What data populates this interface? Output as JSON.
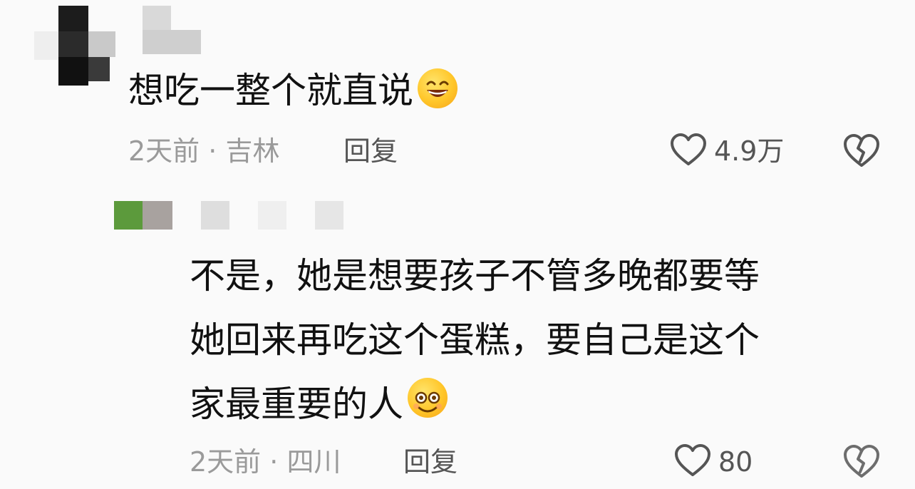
{
  "comment1": {
    "text": "想吃一整个就直说",
    "emoji": "grinning-face-emoji",
    "time": "2天前",
    "location": "吉林",
    "reply_label": "回复",
    "likes": "4.9万"
  },
  "comment2": {
    "lines": [
      "不是，她是想要孩子不管多晚都要等",
      "她回来再吃这个蛋糕，要自己是这个",
      "家最重要的人"
    ],
    "emoji": "smiling-face-emoji",
    "time": "2天前",
    "location": "四川",
    "reply_label": "回复",
    "likes": "80"
  },
  "colors": {
    "meta": "#9a9a9a",
    "text": "#111111",
    "icon": "#555555"
  }
}
